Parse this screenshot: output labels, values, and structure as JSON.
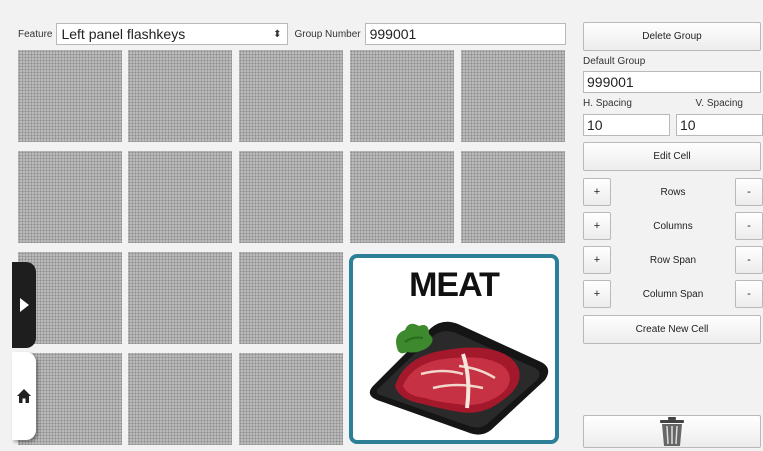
{
  "topbar": {
    "feature_label": "Feature",
    "feature_value": "Left panel flashkeys",
    "group_number_label": "Group Number",
    "group_number_value": "999001"
  },
  "grid": {
    "featured_cell_title": "MEAT"
  },
  "side_handles": {
    "expand_icon": "triangle-right-icon",
    "home_icon": "home-icon"
  },
  "panel": {
    "delete_group_label": "Delete Group",
    "default_group_label": "Default Group",
    "default_group_value": "999001",
    "h_spacing_label": "H. Spacing",
    "v_spacing_label": "V. Spacing",
    "h_spacing_value": "10",
    "v_spacing_value": "10",
    "edit_cell_label": "Edit Cell",
    "controls": [
      {
        "label": "Rows",
        "plus": "+",
        "minus": "-"
      },
      {
        "label": "Columns",
        "plus": "+",
        "minus": "-"
      },
      {
        "label": "Row Span",
        "plus": "+",
        "minus": "-"
      },
      {
        "label": "Column Span",
        "plus": "+",
        "minus": "-"
      }
    ],
    "create_new_cell_label": "Create New Cell",
    "trash_icon": "trash-icon"
  },
  "colors": {
    "featured_cell_border": "#2c7f96",
    "cell_fill": "#b9b9b9",
    "background": "#f2f2f2"
  }
}
